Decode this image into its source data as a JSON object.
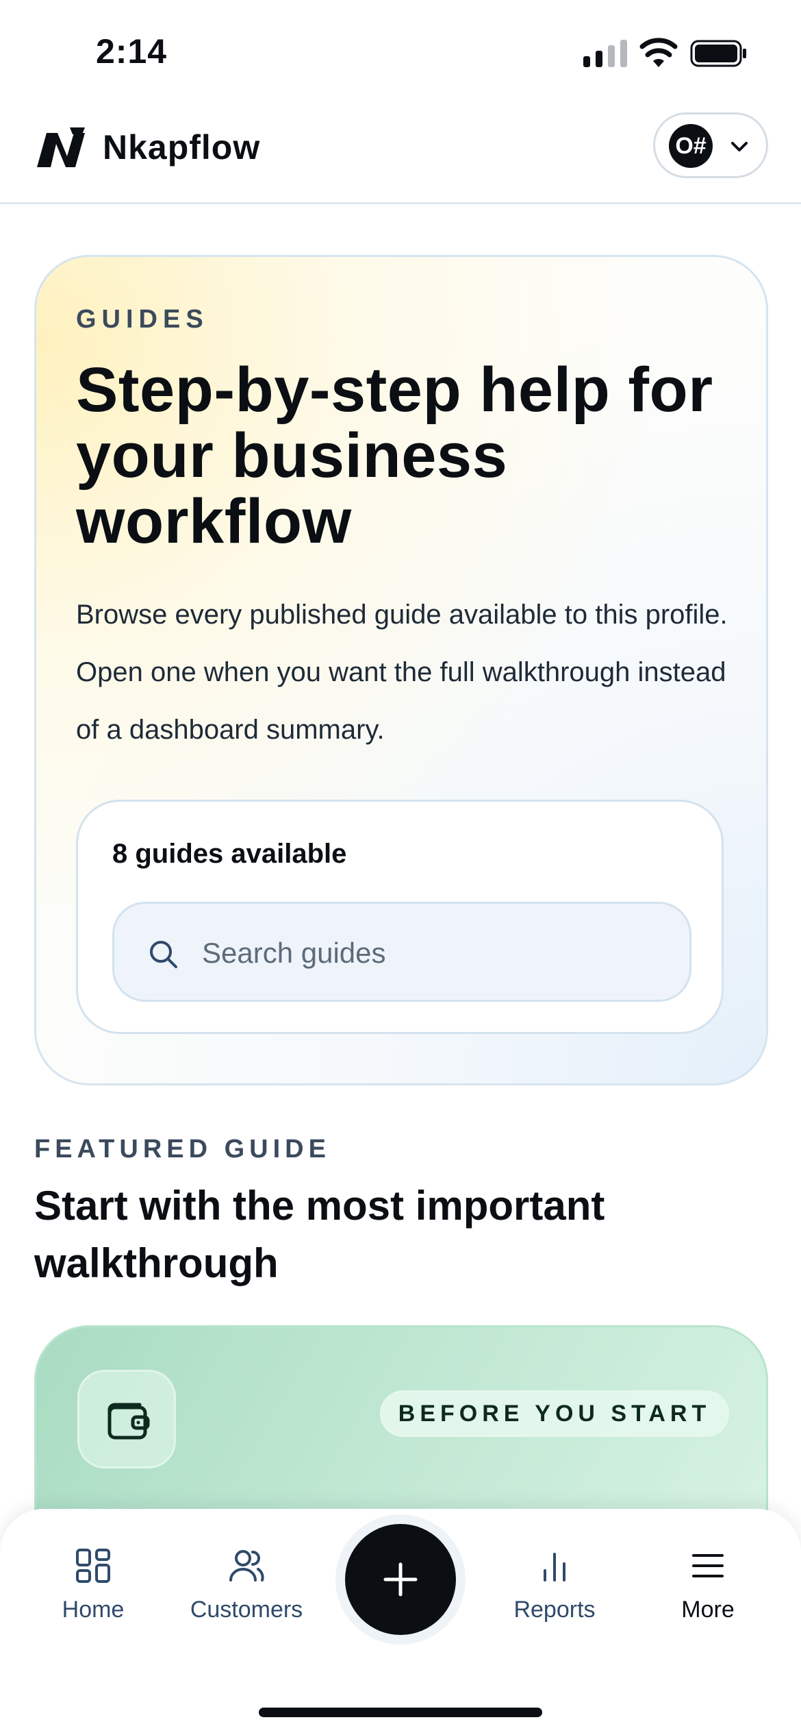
{
  "status_bar": {
    "time": "2:14"
  },
  "header": {
    "brand_name": "Nkapflow",
    "profile_avatar_text": "O#"
  },
  "hero": {
    "eyebrow": "GUIDES",
    "title": "Step-by-step help for your business workflow",
    "description": "Browse every published guide available to this profile. Open one when you want the full walkthrough instead of a dashboard summary.",
    "guides_count": "8 guides available",
    "search": {
      "placeholder": "Search guides",
      "value": ""
    }
  },
  "featured": {
    "eyebrow": "FEATURED GUIDE",
    "title": "Start with the most important walkthrough",
    "badge": "BEFORE YOU START"
  },
  "bottom_nav": {
    "items": [
      {
        "label": "Home",
        "icon": "grid-icon"
      },
      {
        "label": "Customers",
        "icon": "users-icon"
      },
      {
        "label": "Reports",
        "icon": "bar-chart-icon"
      },
      {
        "label": "More",
        "icon": "menu-icon"
      }
    ],
    "fab_icon": "plus-icon"
  },
  "colors": {
    "ink": "#0b0f14",
    "muted_blue": "#2f4a6b",
    "featured_green": "#bfe7d2",
    "hero_yellow": "#fff1c4"
  }
}
